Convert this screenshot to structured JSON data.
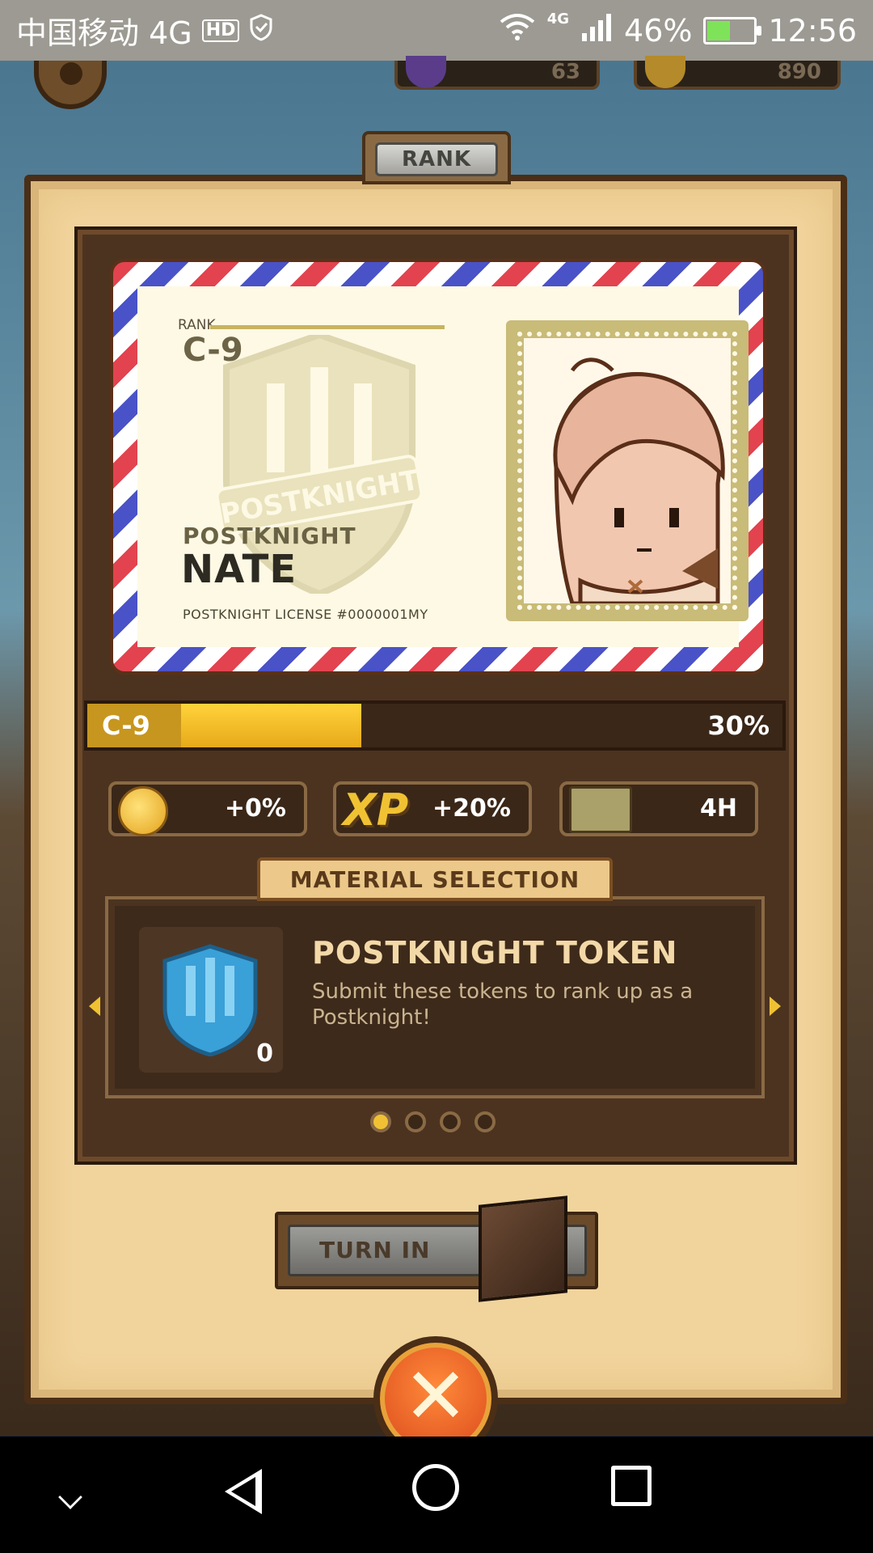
{
  "status_bar": {
    "carrier": "中国移动 4G",
    "hd_badge": "HD",
    "network": "4G",
    "battery_percent": "46%",
    "time": "12:56"
  },
  "top_counters": {
    "gems": "63",
    "coins": "890"
  },
  "panel": {
    "tab_title": "RANK"
  },
  "license_card": {
    "rank_label": "RANK",
    "rank_value": "C-9",
    "crest_text": "POSTKNIGHT",
    "title": "POSTKNIGHT",
    "name": "NATE",
    "license_number": "POSTKNIGHT LICENSE #0000001MY"
  },
  "progress": {
    "level": "C-9",
    "percent_label": "30%",
    "fraction": 0.3
  },
  "bonuses": [
    {
      "icon": "coin-icon",
      "value": "+0%"
    },
    {
      "icon": "xp-icon",
      "label": "XP",
      "value": "+20%"
    },
    {
      "icon": "crate-icon",
      "value": "4H"
    }
  ],
  "material_selection": {
    "tab_label": "MATERIAL SELECTION",
    "item_title": "POSTKNIGHT TOKEN",
    "item_description": "Submit these tokens to rank up as a Postknight!",
    "item_count": "0",
    "page_count": 4,
    "active_page": 1
  },
  "actions": {
    "turn_in_label": "TURN IN",
    "close_label": "✕"
  },
  "colors": {
    "accent_gold": "#f0c233",
    "panel_bg": "#f1d49c",
    "dark_wood": "#4c3320",
    "close_orange": "#d9461a"
  }
}
